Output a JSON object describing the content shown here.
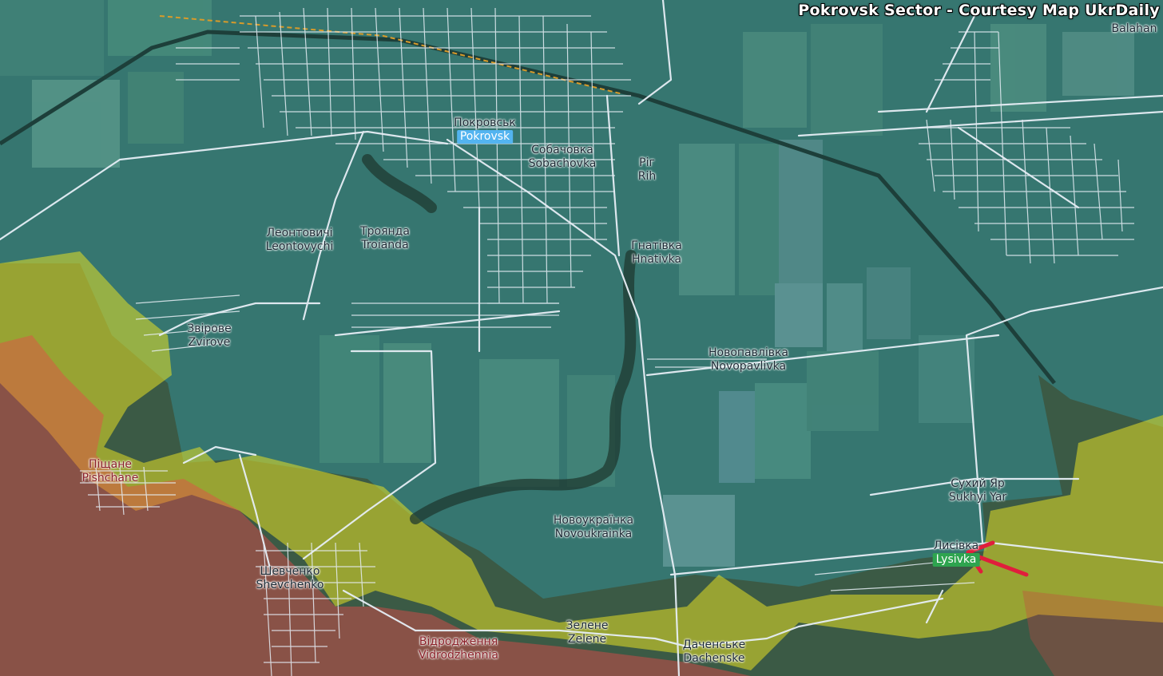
{
  "title": "Pokrovsk Sector - Courtesy Map UkrDaily",
  "colors": {
    "ukraine_controlled": "#2fa6b8",
    "russian_advance": "#e5e024",
    "russian_controlled": "#e84a4a",
    "roads": "#e6eef5",
    "marker_arrow": "#e01e3c",
    "label_text": "#1c2a35"
  },
  "places": [
    {
      "id": "balahan",
      "line1": "",
      "line2": "Balahan",
      "style": "plain"
    },
    {
      "id": "pokrovsk",
      "line1": "Покровськ",
      "line2": "Pokrovsk",
      "style": "blue-highlight"
    },
    {
      "id": "sobachovka",
      "line1": "Собачовка",
      "line2": "Sobachovka",
      "style": "plain"
    },
    {
      "id": "pir-rih",
      "line1": "Рiг",
      "line2": "Rih",
      "style": "plain"
    },
    {
      "id": "leontovychi",
      "line1": "Леонтовичі",
      "line2": "Leontovychi",
      "style": "plain"
    },
    {
      "id": "troianda",
      "line1": "Троянда",
      "line2": "Troianda",
      "style": "plain"
    },
    {
      "id": "hnativka",
      "line1": "Гнатівка",
      "line2": "Hnativka",
      "style": "plain"
    },
    {
      "id": "zvirove",
      "line1": "Звірове",
      "line2": "Zvirove",
      "style": "plain"
    },
    {
      "id": "novopavlivka",
      "line1": "Новопавлівка",
      "line2": "Novopavlivka",
      "style": "plain"
    },
    {
      "id": "pishchane",
      "line1": "Піщане",
      "line2": "Pishchane",
      "style": "red"
    },
    {
      "id": "sukhyi-yar",
      "line1": "Сухий Яр",
      "line2": "Sukhyi Yar",
      "style": "plain"
    },
    {
      "id": "novoukrainka",
      "line1": "Новоукраїнка",
      "line2": "Novoukrainka",
      "style": "plain"
    },
    {
      "id": "lysivka",
      "line1": "Лисівка",
      "line2": "Lysivka",
      "style": "green-highlight"
    },
    {
      "id": "shevchenko",
      "line1": "Шевченко",
      "line2": "Shevchenko",
      "style": "plain"
    },
    {
      "id": "zelene",
      "line1": "Зелене",
      "line2": "Zelene",
      "style": "plain"
    },
    {
      "id": "vidrodzhennia",
      "line1": "Відродження",
      "line2": "Vidrodzhennia",
      "style": "red"
    },
    {
      "id": "dachenske",
      "line1": "Даченське",
      "line2": "Dachenske",
      "style": "plain"
    }
  ],
  "marker": {
    "type": "arrow",
    "points_to": "lysivka"
  }
}
